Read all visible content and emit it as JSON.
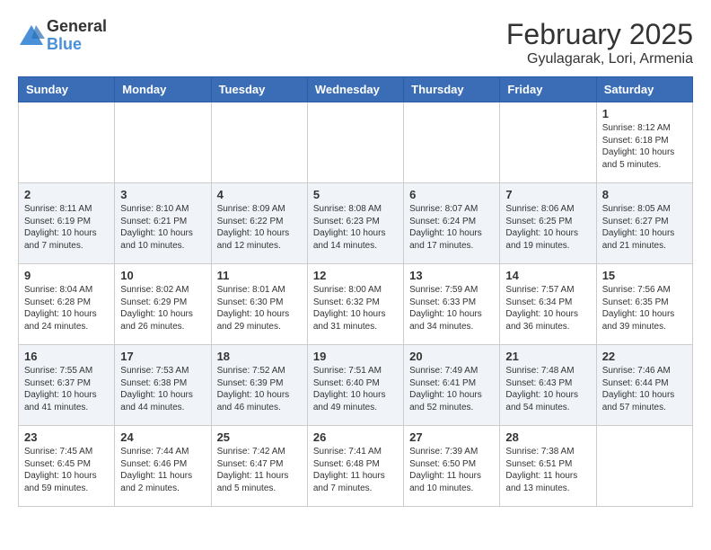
{
  "logo": {
    "general": "General",
    "blue": "Blue"
  },
  "title": "February 2025",
  "location": "Gyulagarak, Lori, Armenia",
  "weekdays": [
    "Sunday",
    "Monday",
    "Tuesday",
    "Wednesday",
    "Thursday",
    "Friday",
    "Saturday"
  ],
  "weeks": [
    [
      {
        "day": "",
        "info": ""
      },
      {
        "day": "",
        "info": ""
      },
      {
        "day": "",
        "info": ""
      },
      {
        "day": "",
        "info": ""
      },
      {
        "day": "",
        "info": ""
      },
      {
        "day": "",
        "info": ""
      },
      {
        "day": "1",
        "info": "Sunrise: 8:12 AM\nSunset: 6:18 PM\nDaylight: 10 hours\nand 5 minutes."
      }
    ],
    [
      {
        "day": "2",
        "info": "Sunrise: 8:11 AM\nSunset: 6:19 PM\nDaylight: 10 hours\nand 7 minutes."
      },
      {
        "day": "3",
        "info": "Sunrise: 8:10 AM\nSunset: 6:21 PM\nDaylight: 10 hours\nand 10 minutes."
      },
      {
        "day": "4",
        "info": "Sunrise: 8:09 AM\nSunset: 6:22 PM\nDaylight: 10 hours\nand 12 minutes."
      },
      {
        "day": "5",
        "info": "Sunrise: 8:08 AM\nSunset: 6:23 PM\nDaylight: 10 hours\nand 14 minutes."
      },
      {
        "day": "6",
        "info": "Sunrise: 8:07 AM\nSunset: 6:24 PM\nDaylight: 10 hours\nand 17 minutes."
      },
      {
        "day": "7",
        "info": "Sunrise: 8:06 AM\nSunset: 6:25 PM\nDaylight: 10 hours\nand 19 minutes."
      },
      {
        "day": "8",
        "info": "Sunrise: 8:05 AM\nSunset: 6:27 PM\nDaylight: 10 hours\nand 21 minutes."
      }
    ],
    [
      {
        "day": "9",
        "info": "Sunrise: 8:04 AM\nSunset: 6:28 PM\nDaylight: 10 hours\nand 24 minutes."
      },
      {
        "day": "10",
        "info": "Sunrise: 8:02 AM\nSunset: 6:29 PM\nDaylight: 10 hours\nand 26 minutes."
      },
      {
        "day": "11",
        "info": "Sunrise: 8:01 AM\nSunset: 6:30 PM\nDaylight: 10 hours\nand 29 minutes."
      },
      {
        "day": "12",
        "info": "Sunrise: 8:00 AM\nSunset: 6:32 PM\nDaylight: 10 hours\nand 31 minutes."
      },
      {
        "day": "13",
        "info": "Sunrise: 7:59 AM\nSunset: 6:33 PM\nDaylight: 10 hours\nand 34 minutes."
      },
      {
        "day": "14",
        "info": "Sunrise: 7:57 AM\nSunset: 6:34 PM\nDaylight: 10 hours\nand 36 minutes."
      },
      {
        "day": "15",
        "info": "Sunrise: 7:56 AM\nSunset: 6:35 PM\nDaylight: 10 hours\nand 39 minutes."
      }
    ],
    [
      {
        "day": "16",
        "info": "Sunrise: 7:55 AM\nSunset: 6:37 PM\nDaylight: 10 hours\nand 41 minutes."
      },
      {
        "day": "17",
        "info": "Sunrise: 7:53 AM\nSunset: 6:38 PM\nDaylight: 10 hours\nand 44 minutes."
      },
      {
        "day": "18",
        "info": "Sunrise: 7:52 AM\nSunset: 6:39 PM\nDaylight: 10 hours\nand 46 minutes."
      },
      {
        "day": "19",
        "info": "Sunrise: 7:51 AM\nSunset: 6:40 PM\nDaylight: 10 hours\nand 49 minutes."
      },
      {
        "day": "20",
        "info": "Sunrise: 7:49 AM\nSunset: 6:41 PM\nDaylight: 10 hours\nand 52 minutes."
      },
      {
        "day": "21",
        "info": "Sunrise: 7:48 AM\nSunset: 6:43 PM\nDaylight: 10 hours\nand 54 minutes."
      },
      {
        "day": "22",
        "info": "Sunrise: 7:46 AM\nSunset: 6:44 PM\nDaylight: 10 hours\nand 57 minutes."
      }
    ],
    [
      {
        "day": "23",
        "info": "Sunrise: 7:45 AM\nSunset: 6:45 PM\nDaylight: 10 hours\nand 59 minutes."
      },
      {
        "day": "24",
        "info": "Sunrise: 7:44 AM\nSunset: 6:46 PM\nDaylight: 11 hours\nand 2 minutes."
      },
      {
        "day": "25",
        "info": "Sunrise: 7:42 AM\nSunset: 6:47 PM\nDaylight: 11 hours\nand 5 minutes."
      },
      {
        "day": "26",
        "info": "Sunrise: 7:41 AM\nSunset: 6:48 PM\nDaylight: 11 hours\nand 7 minutes."
      },
      {
        "day": "27",
        "info": "Sunrise: 7:39 AM\nSunset: 6:50 PM\nDaylight: 11 hours\nand 10 minutes."
      },
      {
        "day": "28",
        "info": "Sunrise: 7:38 AM\nSunset: 6:51 PM\nDaylight: 11 hours\nand 13 minutes."
      },
      {
        "day": "",
        "info": ""
      }
    ]
  ]
}
